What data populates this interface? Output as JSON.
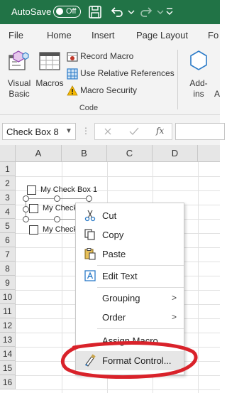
{
  "titlebar": {
    "autosave_label": "AutoSave",
    "autosave_state": "Off",
    "bg_color": "#217346"
  },
  "ribbon_tabs": [
    "File",
    "Home",
    "Insert",
    "Page Layout",
    "Fo"
  ],
  "ribbon": {
    "visual_basic_label_1": "Visual",
    "visual_basic_label_2": "Basic",
    "macros_label": "Macros",
    "record_macro": "Record Macro",
    "relative_refs": "Use Relative References",
    "macro_security": "Macro Security",
    "group_label": "Code",
    "addins_label_1": "Add-",
    "addins_label_2": "ins",
    "addins_cut": "A"
  },
  "formula_bar": {
    "name_box": "Check Box 8",
    "fx_label": "fx"
  },
  "grid": {
    "columns": [
      "A",
      "B",
      "C",
      "D"
    ],
    "rows": [
      "1",
      "2",
      "3",
      "4",
      "5",
      "6",
      "7",
      "8",
      "9",
      "10",
      "11",
      "12",
      "13",
      "14",
      "15",
      "16"
    ]
  },
  "checkboxes": [
    {
      "label": "My Check Box 1"
    },
    {
      "label": "My Check"
    },
    {
      "label": "My Check"
    }
  ],
  "context_menu": {
    "items": [
      {
        "label": "Cut",
        "icon": "scissors-icon"
      },
      {
        "label": "Copy",
        "icon": "copy-icon"
      },
      {
        "label": "Paste",
        "icon": "paste-icon"
      },
      {
        "label": "Edit Text",
        "icon": "edit-text-icon"
      },
      {
        "label": "Grouping",
        "has_submenu": true
      },
      {
        "label": "Order",
        "has_submenu": true
      },
      {
        "label": "Assign Macro..."
      },
      {
        "label": "Format Control...",
        "icon": "format-control-icon",
        "highlighted": true
      }
    ],
    "chevron": ">"
  },
  "annotation": {
    "color": "#d9222a"
  }
}
